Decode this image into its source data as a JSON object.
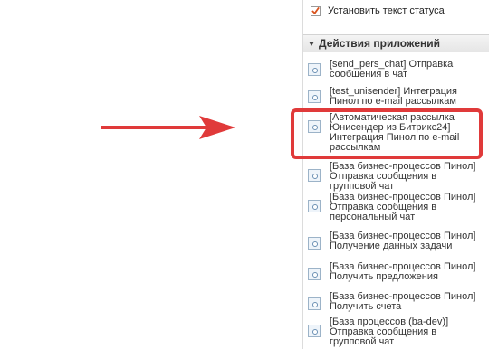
{
  "status_checkbox": {
    "label": "Установить текст статуса",
    "checked": true
  },
  "section": {
    "title": "Действия приложений",
    "icon": "triangle-down-icon"
  },
  "activities": [
    {
      "text": "[send_pers_chat] Отправка сообщения в чат",
      "icon": "activity-icon"
    },
    {
      "text": "[test_unisender] Интеграция Пинол по e-mail рассылкам",
      "icon": "activity-icon"
    },
    {
      "text": "[Автоматическая рассылка Юнисендер из Битрикс24] Интеграция Пинол по e-mail рассылкам",
      "icon": "activity-icon",
      "highlighted": true
    },
    {
      "text": "[База бизнес-процессов Пинол] Отправка сообщения в групповой чат",
      "icon": "activity-icon"
    },
    {
      "text": "[База бизнес-процессов Пинол] Отправка сообщения в персональный чат",
      "icon": "activity-icon"
    },
    {
      "text": "[База бизнес-процессов Пинол] Получение данных задачи",
      "icon": "activity-icon"
    },
    {
      "text": "[База бизнес-процессов Пинол] Получить предложения",
      "icon": "activity-icon"
    },
    {
      "text": "[База бизнес-процессов Пинол] Получить счета",
      "icon": "activity-icon"
    },
    {
      "text": "[База процессов (ba-dev)] Отправка сообщения в групповой чат",
      "icon": "activity-icon"
    }
  ],
  "colors": {
    "highlight": "#e03a3a",
    "arrow": "#e03a3a",
    "icon_border": "#9cb3c8"
  }
}
